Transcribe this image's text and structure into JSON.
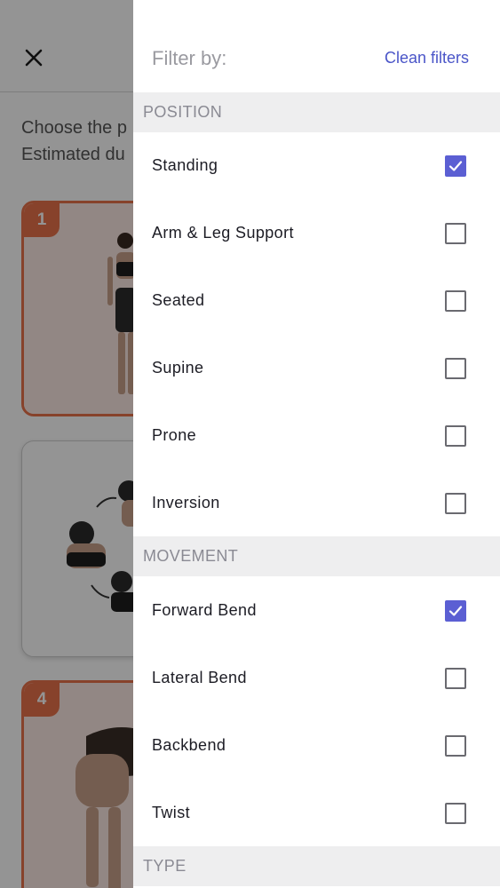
{
  "background": {
    "intro_line1": "Choose the p",
    "intro_line2": "Estimated du",
    "cards": [
      {
        "badge": "1"
      },
      {
        "badge": ""
      },
      {
        "badge": "4"
      }
    ]
  },
  "drawer": {
    "title": "Filter by:",
    "clean_label": "Clean filters",
    "sections": [
      {
        "title": "POSITION",
        "items": [
          {
            "label": "Standing",
            "checked": true
          },
          {
            "label": "Arm & Leg Support",
            "checked": false
          },
          {
            "label": "Seated",
            "checked": false
          },
          {
            "label": "Supine",
            "checked": false
          },
          {
            "label": "Prone",
            "checked": false
          },
          {
            "label": "Inversion",
            "checked": false
          }
        ]
      },
      {
        "title": "MOVEMENT",
        "items": [
          {
            "label": "Forward Bend",
            "checked": true
          },
          {
            "label": "Lateral Bend",
            "checked": false
          },
          {
            "label": "Backbend",
            "checked": false
          },
          {
            "label": "Twist",
            "checked": false
          }
        ]
      },
      {
        "title": "TYPE",
        "items": []
      }
    ]
  },
  "colors": {
    "accent": "#5b5fd3",
    "link": "#4a55c8",
    "card_highlight": "#e8734a"
  },
  "icons": {
    "close": "close-icon",
    "check": "checkmark-icon"
  }
}
